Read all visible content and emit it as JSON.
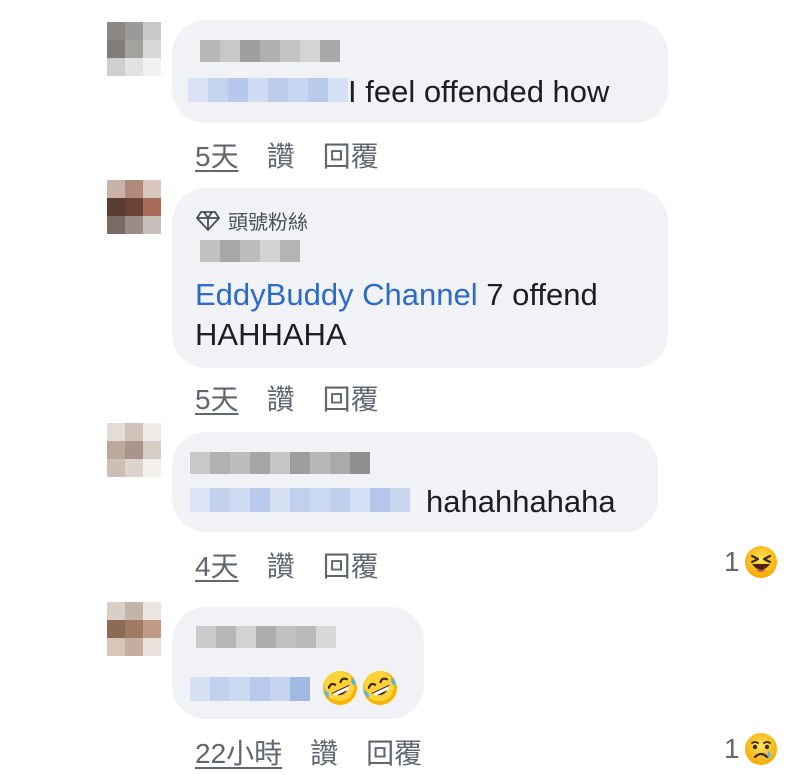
{
  "comments": [
    {
      "message_text": "I feel offended how",
      "time": "5天",
      "like_label": "讚",
      "reply_label": "回覆"
    },
    {
      "badge_label": "頭號粉絲",
      "mention": "EddyBuddy Channel",
      "message_line1_rest": " 7 offend",
      "message_line2": "HAHHAHA",
      "time": "5天",
      "like_label": "讚",
      "reply_label": "回覆"
    },
    {
      "message_text": "hahahhahaha",
      "time": "4天",
      "like_label": "讚",
      "reply_label": "回覆",
      "reaction": {
        "count": "1",
        "icon": "laughing-squint-emoji"
      }
    },
    {
      "emoji_icons": [
        "rolling-on-floor-laughing-emoji",
        "rolling-on-floor-laughing-emoji"
      ],
      "time": "22小時",
      "like_label": "讚",
      "reply_label": "回覆",
      "reaction": {
        "count": "1",
        "icon": "sad-tear-emoji"
      }
    }
  ],
  "colors": {
    "bubble": "#f0f2f5",
    "mention_link": "#2e6bc9",
    "meta_text": "#606770",
    "body_text": "#1c1e21"
  }
}
